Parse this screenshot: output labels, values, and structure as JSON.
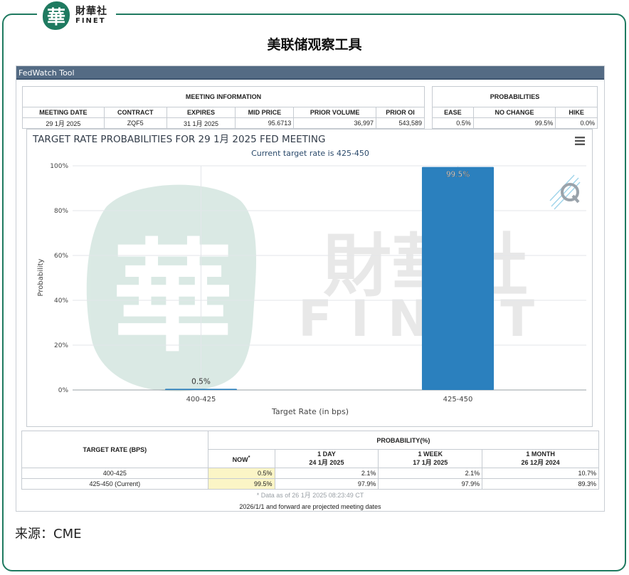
{
  "brand": {
    "seal_char": "華",
    "name_cn": "財華社",
    "name_en": "FINET"
  },
  "page_title": "美联储观察工具",
  "panel_title": "FedWatch Tool",
  "meeting_info": {
    "heading": "MEETING INFORMATION",
    "columns": [
      "MEETING DATE",
      "CONTRACT",
      "EXPIRES",
      "MID PRICE",
      "PRIOR VOLUME",
      "PRIOR OI"
    ],
    "values": [
      "29 1月 2025",
      "ZQF5",
      "31 1月 2025",
      "95.6713",
      "36,997",
      "543,589"
    ]
  },
  "probabilities": {
    "heading": "PROBABILITIES",
    "columns": [
      "EASE",
      "NO CHANGE",
      "HIKE"
    ],
    "values": [
      "0.5%",
      "99.5%",
      "0.0%"
    ]
  },
  "chart_data": {
    "type": "bar",
    "title": "TARGET RATE PROBABILITIES FOR 29 1月 2025 FED MEETING",
    "subtitle": "Current target rate is 425-450",
    "xlabel": "Target Rate (in bps)",
    "ylabel": "Probability",
    "categories": [
      "400-425",
      "425-450"
    ],
    "values": [
      0.5,
      99.5
    ],
    "data_labels": [
      "0.5%",
      "99.5%"
    ],
    "y_ticks": [
      "0%",
      "20%",
      "40%",
      "60%",
      "80%",
      "100%"
    ],
    "ylim": [
      0,
      100
    ],
    "grid": true,
    "bar_color": "#2b80be"
  },
  "chart_ui": {
    "menu_icon": "hamburger-icon",
    "watermark_text_cn": "財華社",
    "watermark_text_en": "FINET"
  },
  "rate_table": {
    "target_heading": "TARGET RATE (BPS)",
    "prob_heading": "PROBABILITY(%)",
    "columns": [
      {
        "label": "NOW",
        "mark": "*",
        "date": ""
      },
      {
        "label": "1 DAY",
        "mark": "",
        "date": "24 1月 2025"
      },
      {
        "label": "1 WEEK",
        "mark": "",
        "date": "17 1月 2025"
      },
      {
        "label": "1 MONTH",
        "mark": "",
        "date": "26 12月 2024"
      }
    ],
    "rows": [
      {
        "rate": "400-425",
        "values": [
          "0.5%",
          "2.1%",
          "2.1%",
          "10.7%"
        ]
      },
      {
        "rate": "425-450 (Current)",
        "values": [
          "99.5%",
          "97.9%",
          "97.9%",
          "89.3%"
        ]
      }
    ],
    "note": "* Data as of 26 1月 2025 08:23:49 CT",
    "footer": "2026/1/1 and forward are projected meeting dates"
  },
  "source": "来源：CME",
  "colors": {
    "frame": "#1f7a60",
    "panel_header": "#546b84",
    "bar": "#2b80be",
    "highlight": "#fbf5c6"
  }
}
